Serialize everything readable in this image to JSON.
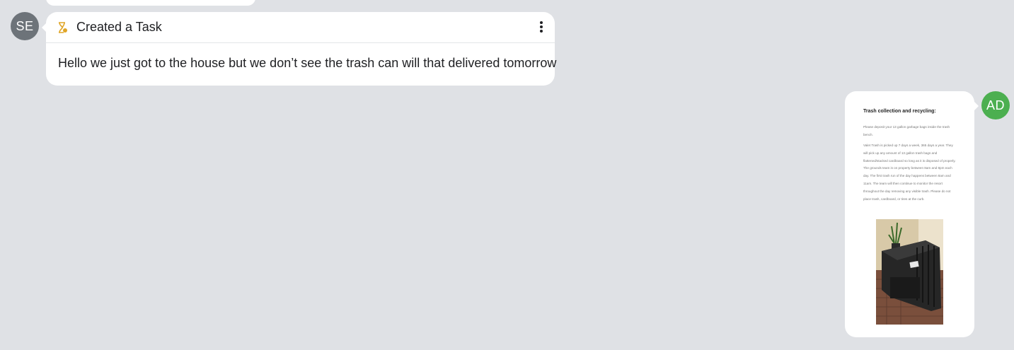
{
  "sender_avatar": {
    "initials": "SE",
    "color": "#6d7379"
  },
  "task_message": {
    "title": "Created a Task",
    "body": "Hello we just got to the house but we don’t see the trash can will that delivered tomorrow",
    "icon": "task-hourglass-icon",
    "menu_icon": "more-vertical-icon"
  },
  "recipient_avatar": {
    "initials": "AD",
    "color": "#4caf50"
  },
  "document_message": {
    "title": "Trash collection and recycling:",
    "paragraph1": "Please deposit your 13 gallon garbage bags inside the trash bench.",
    "paragraph2": "Valet Trash is picked up 7 days a week, 365 days a year. They will pick up any amount of 13 gallon trash bags and flattened/stacked cardboard so long as it is disposed of properly. The grounds team is on property between 8am and 8pm each day. The first trash run of the day happens between 8am and 11am. The team will then continue to monitor the resort throughout the day removing any visible trash. Please do not place trash, cardboard, or tires at the curb.",
    "photo": "trash-bench-photo"
  },
  "colors": {
    "background": "#dfe1e5",
    "bubble": "#ffffff",
    "task_icon": "#e0a526"
  }
}
